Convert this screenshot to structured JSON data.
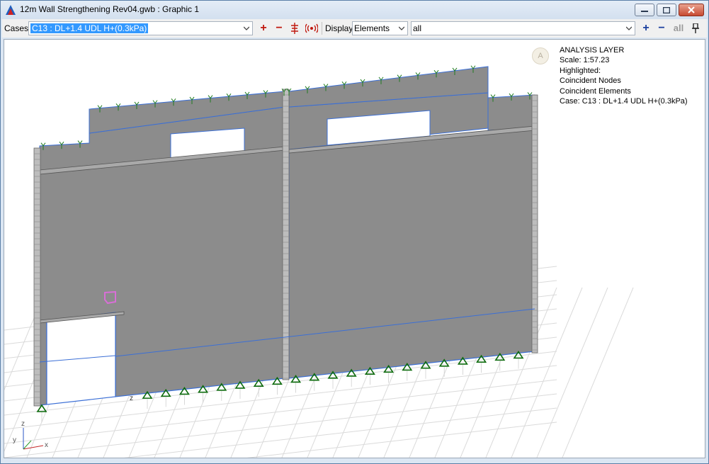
{
  "window": {
    "title": "12m Wall Strengthening Rev04.gwb : Graphic 1"
  },
  "toolbar": {
    "cases_label": "Cases",
    "cases_value": "C13 : DL+1.4 UDL H+(0.3kPa)",
    "add_symbol": "+",
    "remove_symbol": "−",
    "display_label": "Display",
    "display_value": "Elements",
    "filter_value": "all",
    "all_label": "all",
    "add_icon": "plus-icon",
    "remove_icon": "minus-icon",
    "pin_icon": "pin-icon"
  },
  "layer_badge": "A",
  "analysis_layer": {
    "heading": "ANALYSIS LAYER",
    "scale": "Scale: 1:57.23",
    "highlighted": "Highlighted:",
    "coincident_nodes": "Coincident Nodes",
    "coincident_elements": "Coincident Elements",
    "case": "Case: C13 : DL+1.4 UDL H+(0.3kPa)"
  },
  "axes": {
    "z": "z",
    "y": "y",
    "x": "x",
    "node_z": "z"
  },
  "colors": {
    "wall": "#8c8c8c",
    "wall_edge": "#3b6fd6",
    "column": "#b9b9b9",
    "support": "#0d6b0d",
    "grid": "#d9d9d9",
    "red_button": "#c0180e",
    "blue_button": "#1a3f9e"
  }
}
